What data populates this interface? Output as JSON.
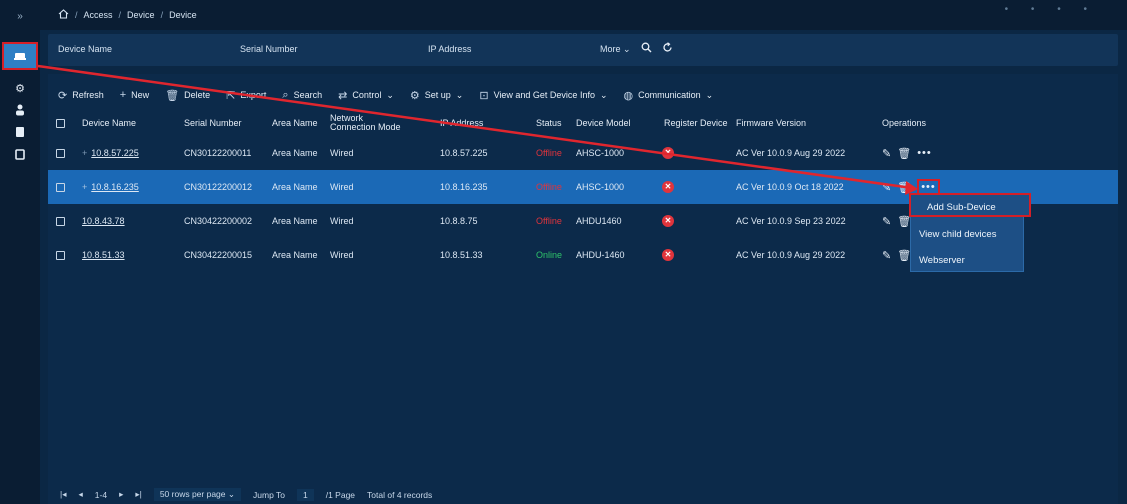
{
  "rail": {
    "collapse_icon": "double-chevron-right-icon",
    "items": [
      "device-icon",
      "gear-icon",
      "person-icon",
      "doc-icon",
      "square-icon"
    ]
  },
  "breadcrumb": {
    "home_icon": "home-icon",
    "items": [
      "Access",
      "Device",
      "Device"
    ]
  },
  "filters": {
    "device_name": "Device Name",
    "serial_number": "Serial Number",
    "ip_address": "IP Address",
    "more": "More"
  },
  "toolbar": {
    "refresh": "Refresh",
    "new": "New",
    "delete": "Delete",
    "export": "Export",
    "search": "Search",
    "control": "Control",
    "setup": "Set up",
    "view_get_info": "View and Get Device Info",
    "communication": "Communication"
  },
  "table": {
    "headers": {
      "device_name": "Device Name",
      "serial_number": "Serial Number",
      "area_name": "Area Name",
      "network_connection_mode": "Network Connection Mode",
      "ip_address": "IP Address",
      "status": "Status",
      "device_model": "Device Model",
      "register_device": "Register Device",
      "firmware_version": "Firmware Version",
      "operations": "Operations"
    },
    "rows": [
      {
        "device_name": "10.8.57.225",
        "serial": "CN30122200011",
        "area": "Area Name",
        "mode": "Wired",
        "ip": "10.8.57.225",
        "status": "Offline",
        "model": "AHSC-1000",
        "firmware": "AC Ver 10.0.9 Aug 29 2022"
      },
      {
        "device_name": "10.8.16.235",
        "serial": "CN30122200012",
        "area": "Area Name",
        "mode": "Wired",
        "ip": "10.8.16.235",
        "status": "Offline",
        "model": "AHSC-1000",
        "firmware": "AC Ver 10.0.9 Oct 18 2022"
      },
      {
        "device_name": "10.8.43.78",
        "serial": "CN30422200002",
        "area": "Area Name",
        "mode": "Wired",
        "ip": "10.8.8.75",
        "status": "Offline",
        "model": "AHDU1460",
        "firmware": "AC Ver 10.0.9 Sep 23 2022"
      },
      {
        "device_name": "10.8.51.33",
        "serial": "CN30422200015",
        "area": "Area Name",
        "mode": "Wired",
        "ip": "10.8.51.33",
        "status": "Online",
        "model": "AHDU-1460",
        "firmware": "AC Ver 10.0.9 Aug 29 2022"
      }
    ]
  },
  "dropdown": {
    "items": [
      "Add Sub-Device",
      "View child devices",
      "Webserver"
    ]
  },
  "pager": {
    "range": "1-4",
    "rows_per_page": "50 rows per page",
    "jump_to": "Jump To",
    "page_input": "1",
    "page_total": "/1 Page",
    "total": "Total of 4 records"
  },
  "colors": {
    "accent": "#1b69b6",
    "highlight": "#d51f27",
    "offline": "#e0343c",
    "online": "#2fc46a"
  }
}
